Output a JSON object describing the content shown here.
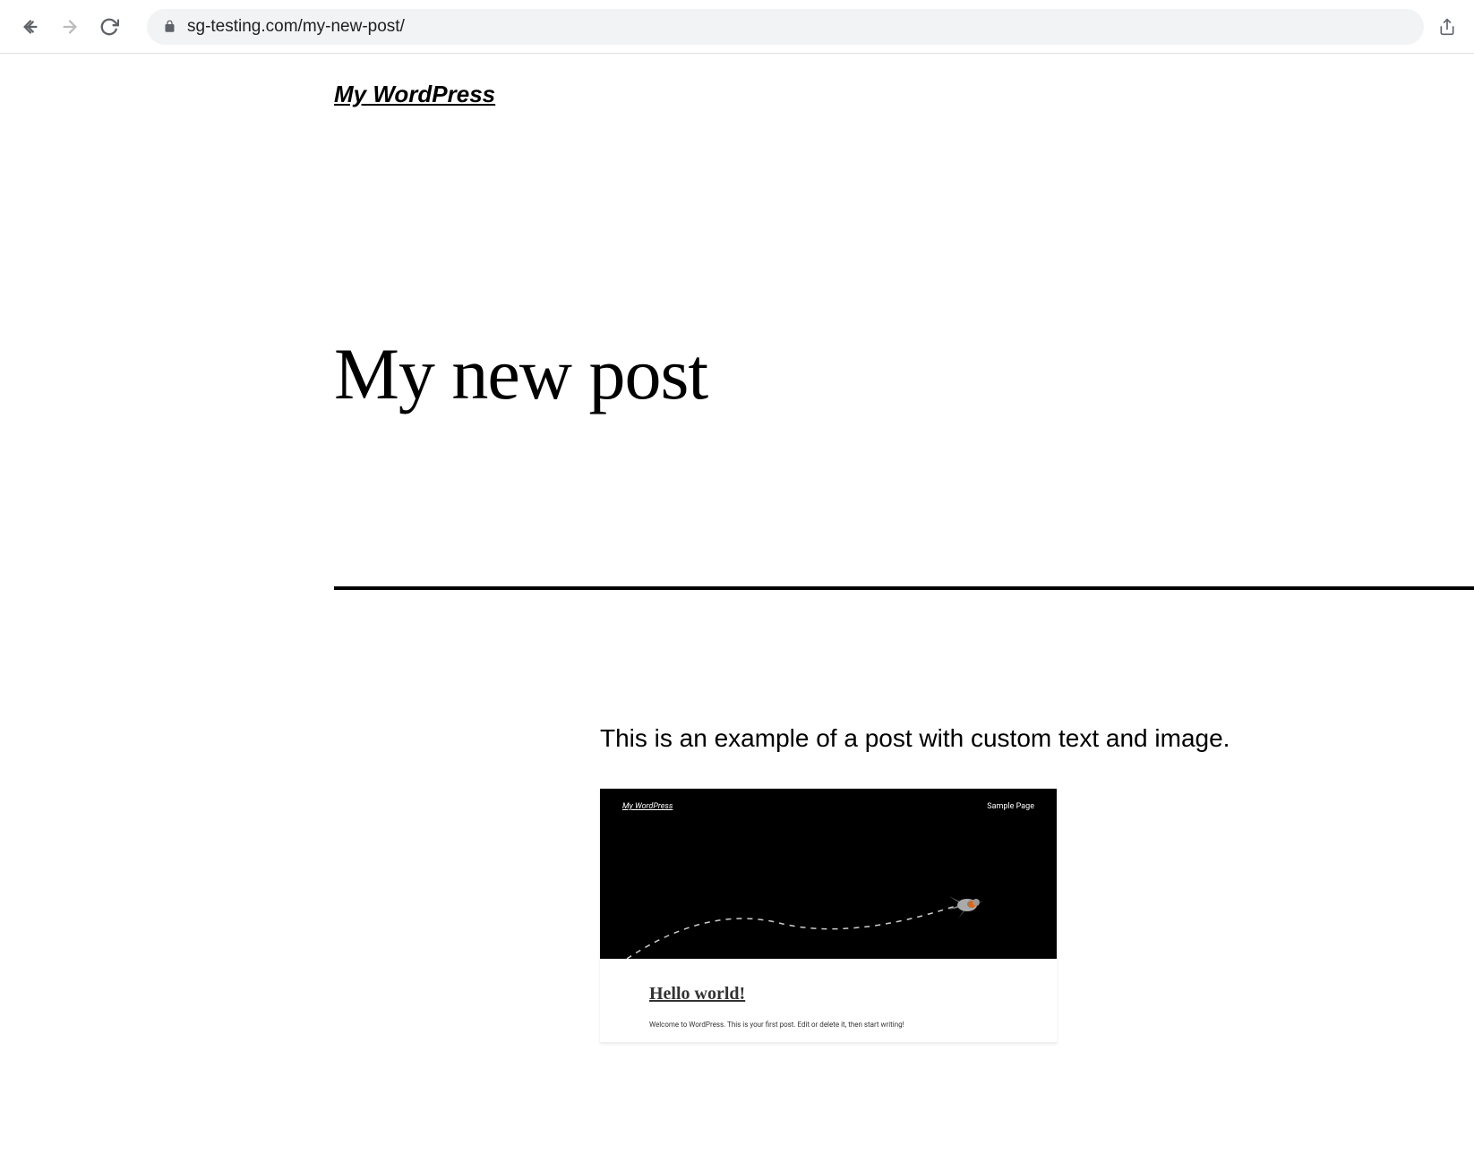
{
  "browser": {
    "url": "sg-testing.com/my-new-post/"
  },
  "site": {
    "title": "My WordPress"
  },
  "post": {
    "title": "My new post",
    "body_text": "This is an example of a post with custom text and image."
  },
  "embedded": {
    "site_title": "My WordPress",
    "nav_item": "Sample Page",
    "post_title": "Hello world!",
    "excerpt": "Welcome to WordPress. This is your first post. Edit or delete it, then start writing!"
  }
}
